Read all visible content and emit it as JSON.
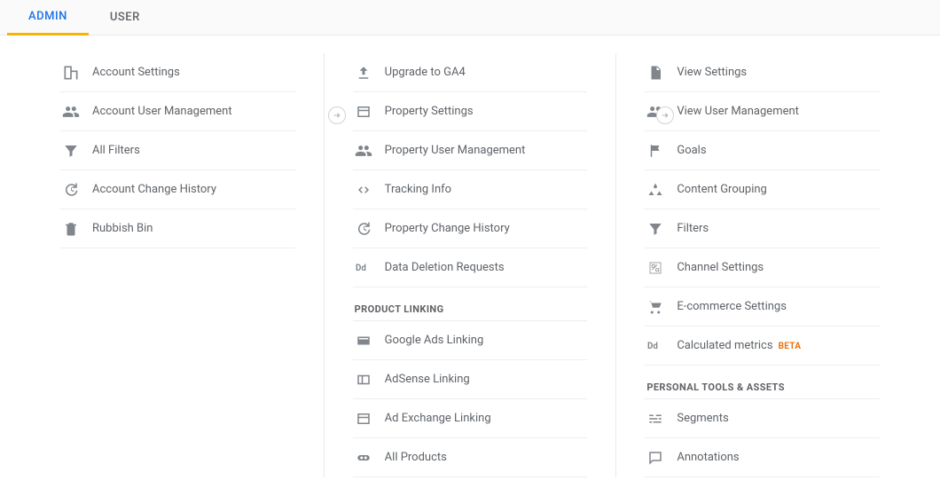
{
  "tabs": {
    "admin": "ADMIN",
    "user": "USER"
  },
  "account": {
    "settings": "Account Settings",
    "user_mgmt": "Account User Management",
    "filters": "All Filters",
    "history": "Account Change History",
    "bin": "Rubbish Bin"
  },
  "property": {
    "upgrade": "Upgrade to GA4",
    "settings": "Property Settings",
    "user_mgmt": "Property User Management",
    "tracking": "Tracking Info",
    "history": "Property Change History",
    "deletion": "Data Deletion Requests",
    "product_linking_head": "PRODUCT LINKING",
    "ads": "Google Ads Linking",
    "adsense": "AdSense Linking",
    "adexchange": "Ad Exchange Linking",
    "all_products": "All Products"
  },
  "view": {
    "settings": "View Settings",
    "user_mgmt": "View User Management",
    "goals": "Goals",
    "content_grouping": "Content Grouping",
    "filters": "Filters",
    "channel": "Channel Settings",
    "ecommerce": "E-commerce Settings",
    "calc_metrics": "Calculated metrics",
    "calc_badge": "BETA",
    "personal_head": "PERSONAL TOOLS & ASSETS",
    "segments": "Segments",
    "annotations": "Annotations"
  }
}
